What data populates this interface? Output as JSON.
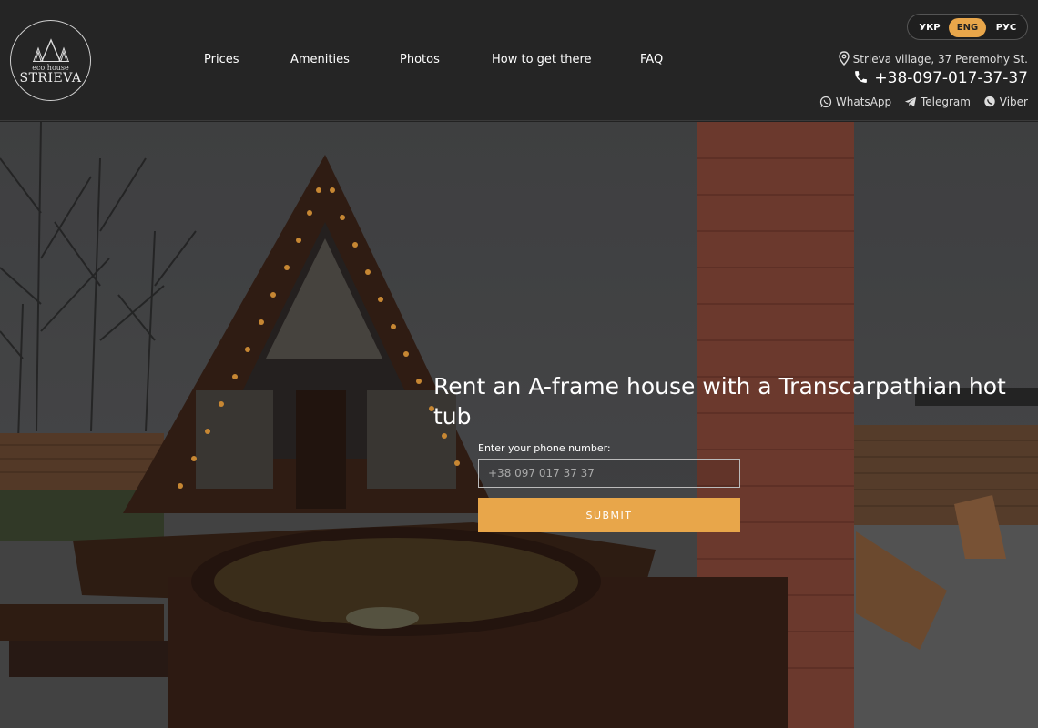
{
  "logo": {
    "sub": "eco house",
    "name": "STRIEVA"
  },
  "nav": [
    "Prices",
    "Amenities",
    "Photos",
    "How to get there",
    "FAQ"
  ],
  "languages": [
    {
      "label": "УКР",
      "active": false
    },
    {
      "label": "ENG",
      "active": true
    },
    {
      "label": "РУС",
      "active": false
    }
  ],
  "contact": {
    "address": "Strieva village, 37 Peremohy St.",
    "phone": "+38-097-017-37-37",
    "socials": [
      "WhatsApp",
      "Telegram",
      "Viber"
    ]
  },
  "hero": {
    "headline": "Rent an A-frame house with a Transcarpathian hot tub",
    "phone_label": "Enter your phone number:",
    "phone_placeholder": "+38 097 017 37 37",
    "submit_label": "SUBMIT"
  },
  "colors": {
    "accent": "#e8a64a",
    "header_bg": "#252525"
  }
}
